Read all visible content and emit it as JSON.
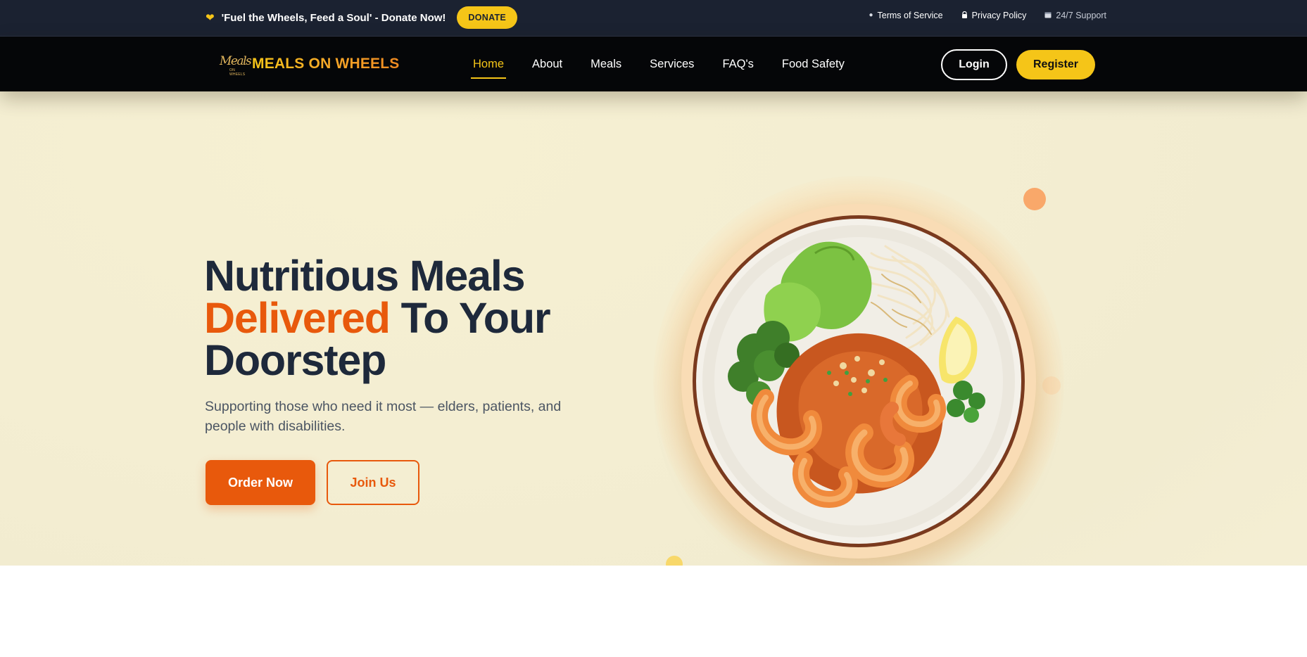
{
  "topbar": {
    "message": "'Fuel the Wheels, Feed a Soul' - Donate Now!",
    "donate_label": "DONATE",
    "links": [
      {
        "label": "Terms of Service",
        "icon": "info-icon"
      },
      {
        "label": "Privacy Policy",
        "icon": "lock-icon"
      },
      {
        "label": "24/7 Support",
        "icon": "calendar-icon"
      }
    ]
  },
  "brand": {
    "logo_text": "Meals",
    "logo_subtext": "ON WHEELS",
    "name": "MEALS ON WHEELS"
  },
  "nav": {
    "items": [
      {
        "label": "Home",
        "active": true
      },
      {
        "label": "About"
      },
      {
        "label": "Meals"
      },
      {
        "label": "Services"
      },
      {
        "label": "FAQ's"
      },
      {
        "label": "Food Safety"
      }
    ],
    "login_label": "Login",
    "register_label": "Register"
  },
  "hero": {
    "headline_line1": "Nutritious Meals",
    "headline_accent": "Delivered",
    "headline_line2_rest": " To Your",
    "headline_line3": "Doorstep",
    "subtext": "Supporting those who need it most — elders, patients, and people with disabilities.",
    "order_label": "Order Now",
    "join_label": "Join Us"
  },
  "colors": {
    "accent": "#e8590c",
    "brand_yellow": "#f5c518",
    "topbar_bg": "#1b2231",
    "navbar_bg": "#050608",
    "hero_bg": "#f4eed2",
    "heading": "#1e293b"
  }
}
